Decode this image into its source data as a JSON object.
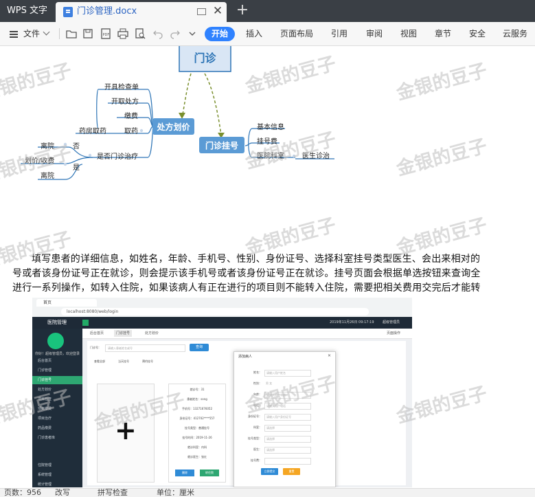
{
  "titlebar": {
    "app_name": "WPS 文字",
    "doc_title": "门诊管理.docx",
    "new_tab_symbol": "+",
    "close_symbol": "✕"
  },
  "toolbar": {
    "file_menu": "文件",
    "tabs": [
      "开始",
      "插入",
      "页面布局",
      "引用",
      "审阅",
      "视图",
      "章节",
      "安全",
      "云服务"
    ],
    "accent": "#2f82ff"
  },
  "mindmap": {
    "root": "门诊",
    "branch_left": "处方划价",
    "branch_right": "门诊挂号",
    "left_items": [
      "开具检查单",
      "开取处方",
      "缴费",
      "取药",
      "药房取药",
      "是否门诊治疗",
      "否",
      "是",
      "离院",
      "划价/收费",
      "离院"
    ],
    "right_items": [
      "基本信息",
      "挂号费",
      "医院科室",
      "医生诊治"
    ]
  },
  "paragraph": {
    "line1": "填写患者的详细信息，如姓名，年龄、手机号、性别、身份证号、选择科室挂号类型医生、会出来相对的",
    "line2": "号或者该身份证号正在就诊，则会提示该手机号或者该身份证号正在就诊。挂号页面会根据单选按钮来查询全",
    "line3": "进行一系列操作，如转入住院，如果该病人有正在进行的项目则不能转入住院，需要把相关费用交完后才能转"
  },
  "watermark": "金银的豆子",
  "embedded": {
    "browser_tab": "首页",
    "url": "localhost:8080/web/login",
    "app_name": "医院管理",
    "datetime": "2019年11月26日 09:17:19",
    "user": "超级管理员",
    "welcome": "你好！超级管理员，欢迎登录",
    "tabs": [
      "后台首页",
      "门诊挂号",
      "处方划价",
      "页面操作"
    ],
    "sidebar": [
      "后台首页",
      "门诊管理",
      "门诊挂号",
      "处方划价",
      "项目检查",
      "项目缴费",
      "项目治疗",
      "药品缴费",
      "门诊患者库",
      "住院管理",
      "系统管理",
      "统计管理"
    ],
    "search_label": "门诊号：",
    "search_placeholder": "请输入患者姓名或号",
    "search_button": "查询",
    "radio_options": [
      "查看全部",
      "当天挂号",
      "预约挂号"
    ],
    "plus": "+",
    "info_rows": [
      "就诊号：31",
      "患者姓名：song",
      "手机号：13271676052",
      "身份证号：412702****557",
      "挂号类型：普通挂号",
      "挂号时间：2019-11-26",
      "就诊科室：内科",
      "就诊医生：张红"
    ],
    "info_buttons": [
      "删除",
      "转住院"
    ],
    "modal_title": "添加病人",
    "modal_fields": [
      {
        "label": "姓名：",
        "placeholder": "请输入用户姓名"
      },
      {
        "label": "性别：",
        "placeholder": "男  女"
      },
      {
        "label": "年龄：",
        "placeholder": "请输入用户年龄"
      },
      {
        "label": "电话：",
        "placeholder": "请输入用户电话"
      },
      {
        "label": "身份证号：",
        "placeholder": "请输入用户身份证号"
      },
      {
        "label": "科室：",
        "placeholder": "请选择"
      },
      {
        "label": "挂号类型：",
        "placeholder": "请选择"
      },
      {
        "label": "医生：",
        "placeholder": "请选择"
      },
      {
        "label": "挂号费：",
        "placeholder": ""
      }
    ],
    "submit": "立即提交",
    "reset": "重置"
  },
  "statusbar": [
    "页数：956",
    "改写",
    "拼写检查",
    "单位：厘米"
  ]
}
